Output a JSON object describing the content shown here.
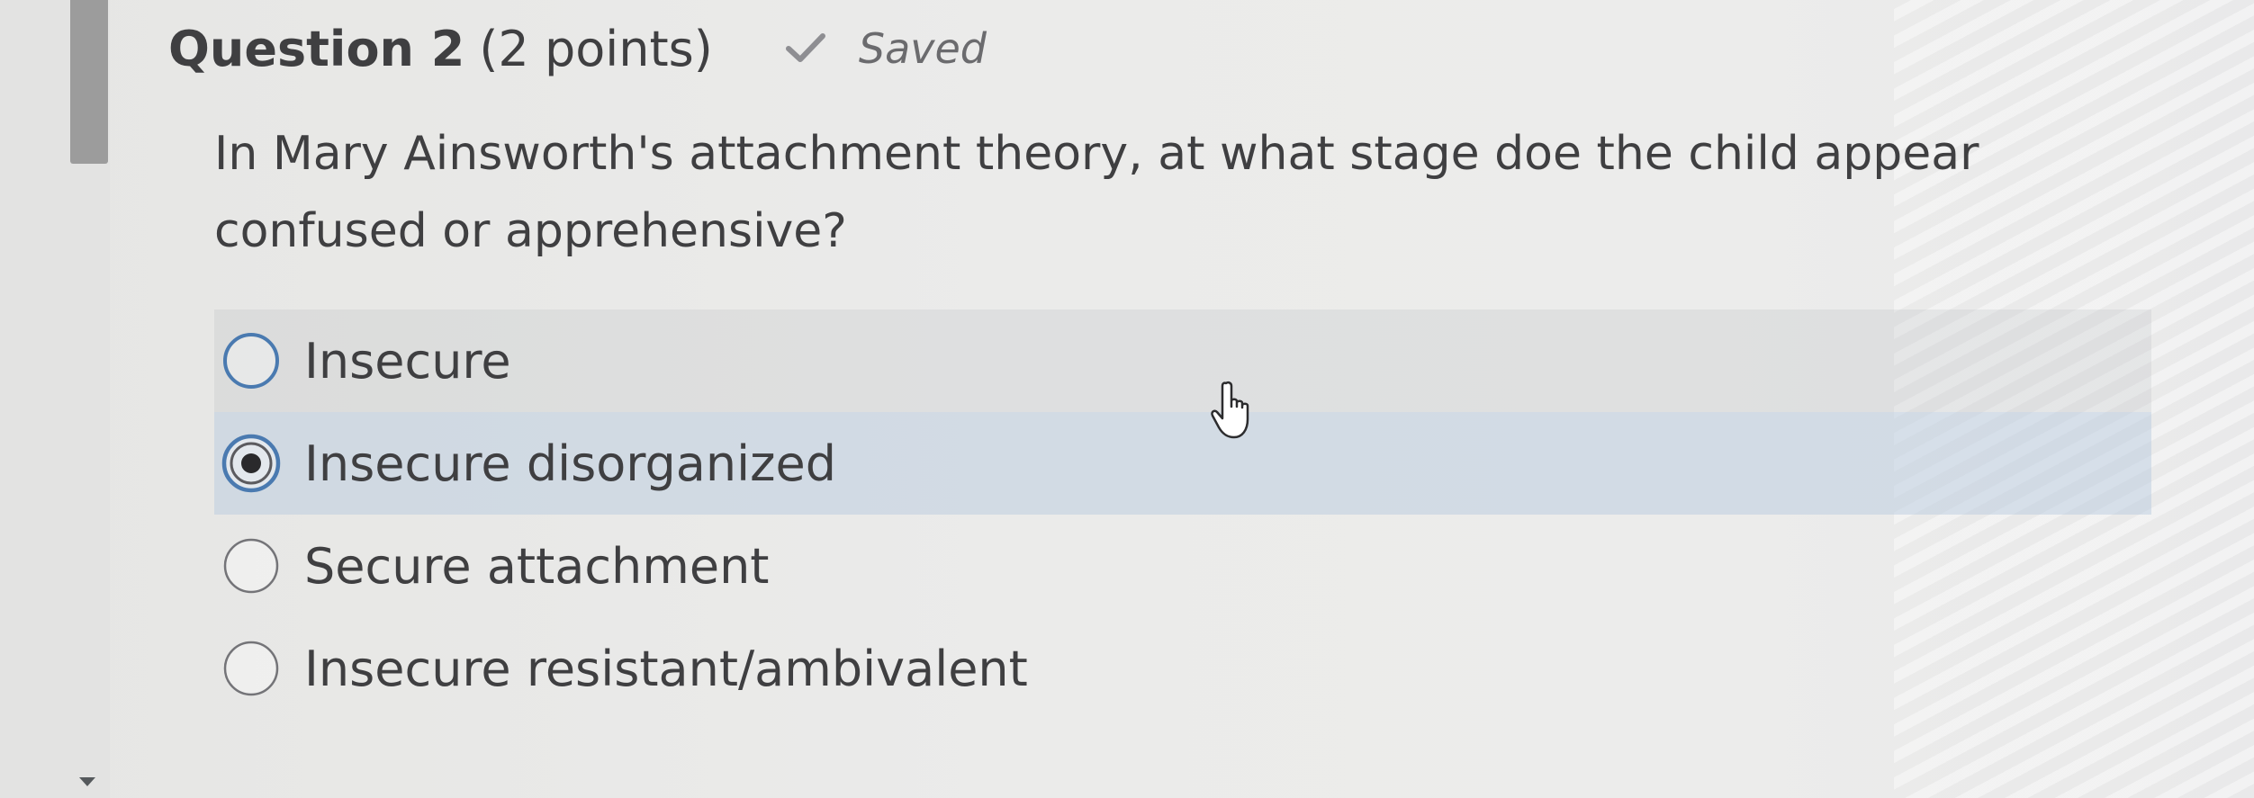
{
  "question": {
    "title": "Question 2",
    "points": "(2 points)",
    "status": "Saved",
    "text": "In Mary Ainsworth's attachment theory, at what stage doe the child appear confused or apprehensive?"
  },
  "options": [
    {
      "label": "Insecure",
      "selected": false
    },
    {
      "label": "Insecure disorganized",
      "selected": true
    },
    {
      "label": "Secure attachment",
      "selected": false
    },
    {
      "label": "Insecure resistant/ambivalent",
      "selected": false
    }
  ],
  "icons": {
    "saved": "checkmark-icon",
    "cursor": "hand-pointer-icon",
    "scroll": "chevron-down-icon"
  },
  "colors": {
    "radio_focus": "#4a7ab0",
    "radio_default": "#747478",
    "selected_row": "#d2dcea",
    "hover_row": "#dcdcdc"
  }
}
